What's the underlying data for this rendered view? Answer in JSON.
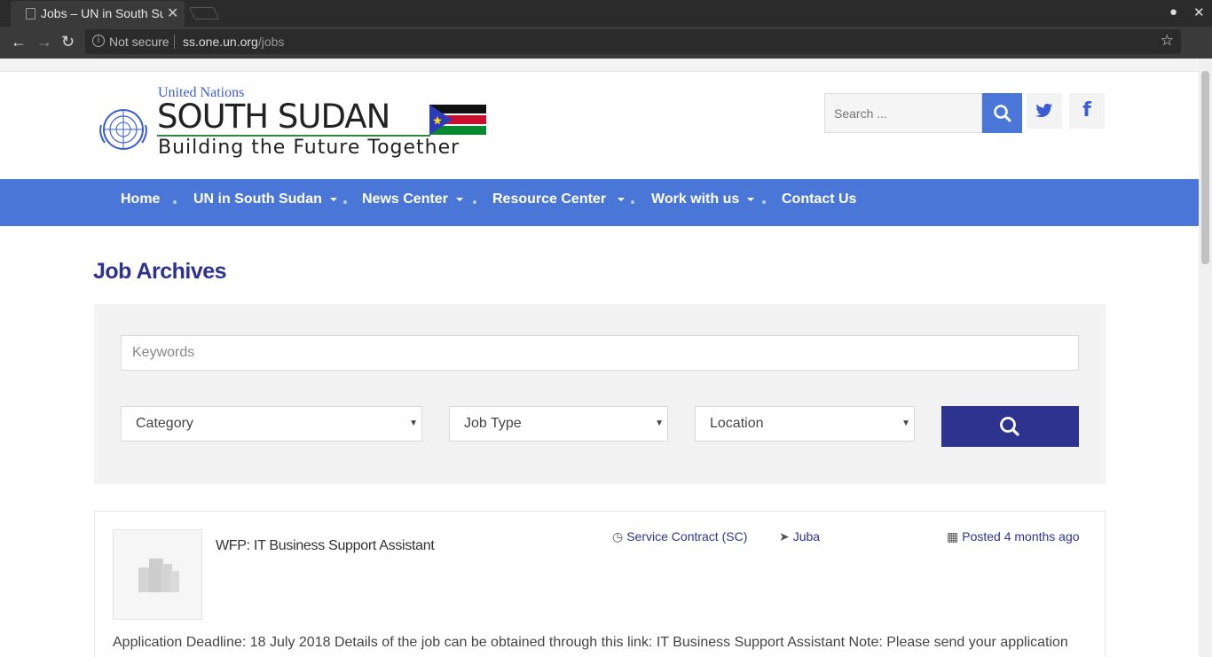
{
  "browser": {
    "tab_title": "Jobs – UN in South Sudan",
    "security_label": "Not secure",
    "url_host": "ss.one.un.org",
    "url_path": "/jobs"
  },
  "header": {
    "logo_un": "United Nations",
    "logo_country": "SOUTH SUDAN",
    "logo_tagline": "Building the Future Together",
    "search_placeholder": "Search ...",
    "social": [
      "twitter-icon",
      "facebook-icon"
    ]
  },
  "nav": {
    "items": [
      {
        "label": "Home",
        "has_dropdown": false
      },
      {
        "label": "UN in South Sudan",
        "has_dropdown": true
      },
      {
        "label": "News Center",
        "has_dropdown": true
      },
      {
        "label": "Resource Center",
        "has_dropdown": true
      },
      {
        "label": "Work with us",
        "has_dropdown": true
      },
      {
        "label": "Contact Us",
        "has_dropdown": false
      }
    ]
  },
  "main": {
    "title": "Job Archives",
    "filters": {
      "keywords_placeholder": "Keywords",
      "category": "Category",
      "job_type": "Job Type",
      "location": "Location"
    },
    "jobs": [
      {
        "title": "WFP: IT Business Support Assistant",
        "contract": "Service Contract (SC)",
        "location": "Juba",
        "posted": "Posted 4 months ago",
        "description": "Application Deadline: 18 July 2018 Details of the job can be obtained through this link: IT Business Support Assistant Note: Please send your application"
      }
    ]
  },
  "colors": {
    "nav_bg": "#4a76d8",
    "title_color": "#2e338f",
    "filter_button": "#2e338f"
  }
}
